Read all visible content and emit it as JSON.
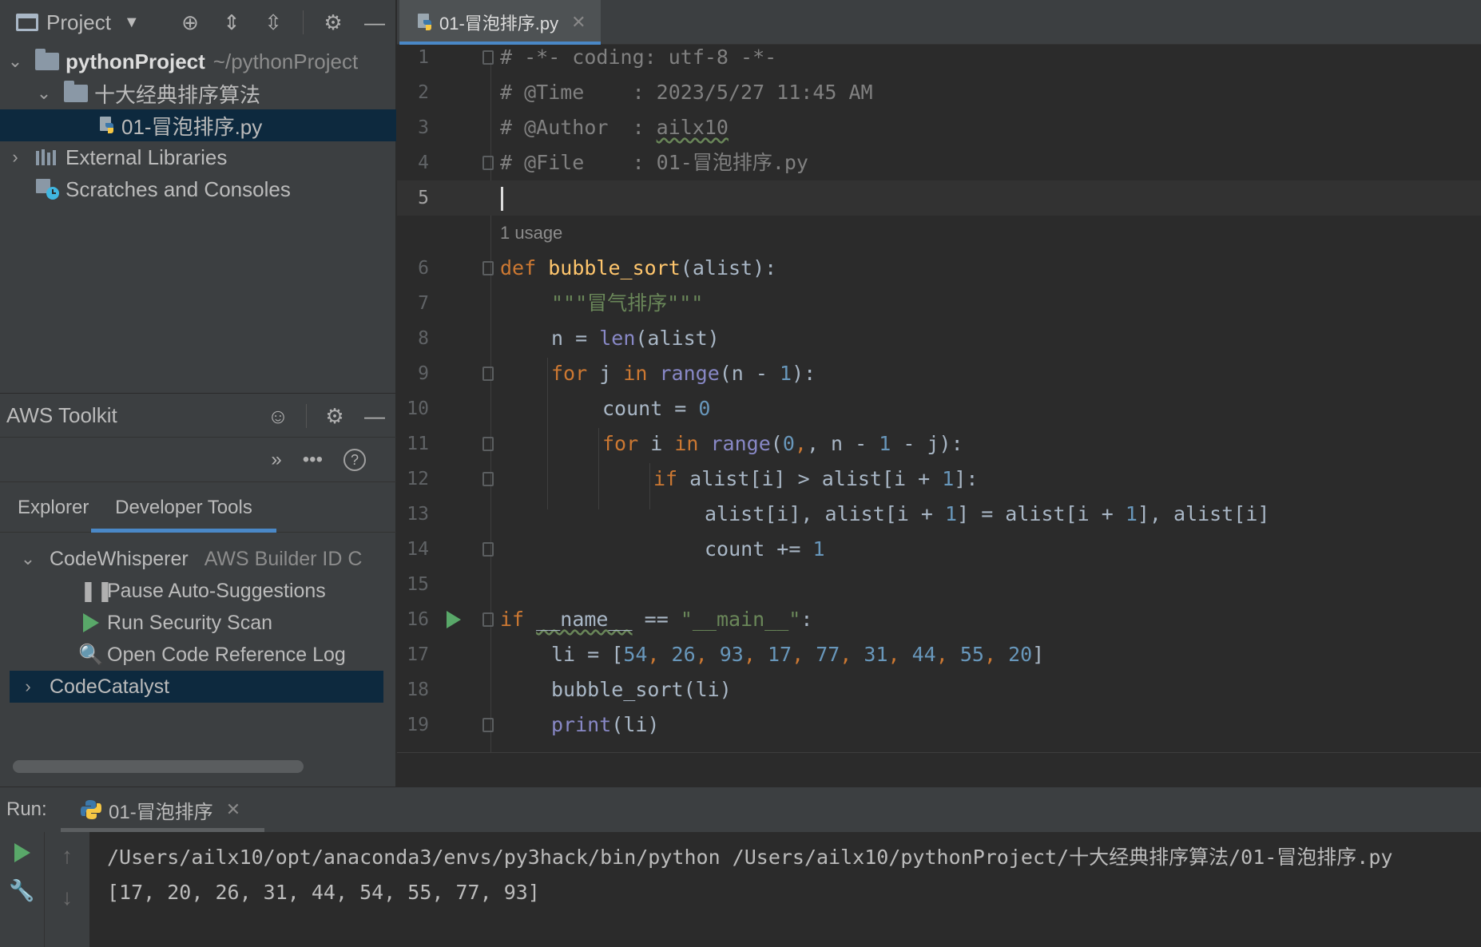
{
  "project_panel": {
    "title": "Project",
    "tree": {
      "root_name": "pythonProject",
      "root_path": "~/pythonProject",
      "folder": "十大经典排序算法",
      "file": "01-冒泡排序.py",
      "external": "External Libraries",
      "scratches": "Scratches and Consoles"
    }
  },
  "aws_toolkit": {
    "title": "AWS Toolkit",
    "tabs": [
      "Explorer",
      "Developer Tools"
    ],
    "active_tab": "Developer Tools",
    "codewhisperer": "CodeWhisperer",
    "codewhisperer_status": "AWS Builder ID C",
    "items": [
      "Pause Auto-Suggestions",
      "Run Security Scan",
      "Open Code Reference Log"
    ],
    "codecatalyst": "CodeCatalyst"
  },
  "editor": {
    "tab_label": "01-冒泡排序.py",
    "usage_hint": "1 usage",
    "line_numbers": [
      "1",
      "2",
      "3",
      "4",
      "5",
      "6",
      "7",
      "8",
      "9",
      "10",
      "11",
      "12",
      "13",
      "14",
      "15",
      "16",
      "17",
      "18",
      "19"
    ],
    "code": {
      "l1": "# -*- coding: utf-8 -*-",
      "l2": "# @Time    : 2023/5/27 11:45 AM",
      "l3_prefix": "# @Author  : ",
      "l3_author": "ailx10",
      "l4": "# @File    : 01-冒泡排序.py",
      "def_kw": "def",
      "func_name": "bubble_sort",
      "func_args": "(alist):",
      "docstring": "\"\"\"冒气排序\"\"\"",
      "l8_a": "n = ",
      "len": "len",
      "l8_b": "(alist)",
      "for": "for",
      "in": "in",
      "range": "range",
      "l9_a": " j ",
      "l9_b": "(n - ",
      "one": "1",
      "zero": "0",
      "l9_c": "):",
      "l10_a": "count = ",
      "l11_a": " i ",
      "l11_b": "(",
      "l11_c": ", n - ",
      "l11_d": " - j):",
      "if": "if",
      "l12_a": " alist[i] > alist[i + ",
      "l12_b": "]:",
      "l13_a": "alist[i], alist[i + ",
      "l13_b": "] = alist[i + ",
      "l13_c": "], alist[i]",
      "l14_a": "count += ",
      "l16_name": "__name__",
      "l16_eq": " == ",
      "l16_main": "\"__main__\"",
      "l16_colon": ":",
      "l17_a": "li = [",
      "li_values": [
        "54",
        "26",
        "93",
        "17",
        "77",
        "31",
        "44",
        "55",
        "20"
      ],
      "l17_b": "]",
      "l18": "bubble_sort(li)",
      "print": "print",
      "l19_b": "(li)"
    }
  },
  "run_panel": {
    "label": "Run:",
    "tab": "01-冒泡排序",
    "command": "/Users/ailx10/opt/anaconda3/envs/py3hack/bin/python /Users/ailx10/pythonProject/十大经典排序算法/01-冒泡排序.py",
    "output": "[17, 20, 26, 31, 44, 54, 55, 77, 93]"
  }
}
